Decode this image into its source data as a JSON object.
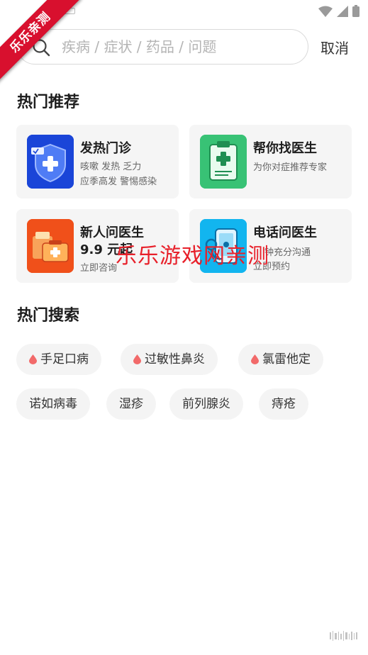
{
  "ribbon": {
    "text": "乐乐亲测"
  },
  "watermark": {
    "text": "乐乐游戏网亲测"
  },
  "search": {
    "placeholder": "疾病 / 症状 / 药品 / 问题",
    "value": "",
    "cancel_label": "取消"
  },
  "hot_recommend": {
    "title": "热门推荐",
    "cards": [
      {
        "title": "发热门诊",
        "line1": "咳嗽 发热 乏力",
        "line2": "应季高发  警惕感染",
        "icon": "shield-plus-icon"
      },
      {
        "title": "帮你找医生",
        "line1": "为你对症推荐专家",
        "icon": "clipboard-plus-icon"
      },
      {
        "title": "新人问医生",
        "line1": "9.9 元起",
        "line2": "立即咨询",
        "icon": "medical-kit-icon"
      },
      {
        "title": "电话问医生",
        "line1": "钟充分沟通",
        "line2": "立即预约",
        "icon": "stethoscope-phone-icon"
      }
    ]
  },
  "hot_search": {
    "title": "热门搜索",
    "tags": [
      {
        "label": "手足口病",
        "hot": true
      },
      {
        "label": "过敏性鼻炎",
        "hot": true
      },
      {
        "label": "氯雷他定",
        "hot": true
      },
      {
        "label": "诺如病毒",
        "hot": false
      },
      {
        "label": "湿疹",
        "hot": false
      },
      {
        "label": "前列腺炎",
        "hot": false
      },
      {
        "label": "痔疮",
        "hot": false
      }
    ]
  },
  "colors": {
    "accent_red": "#e8202a",
    "hot_drop": "#f26a6a",
    "card_bg": "#f5f5f5"
  }
}
